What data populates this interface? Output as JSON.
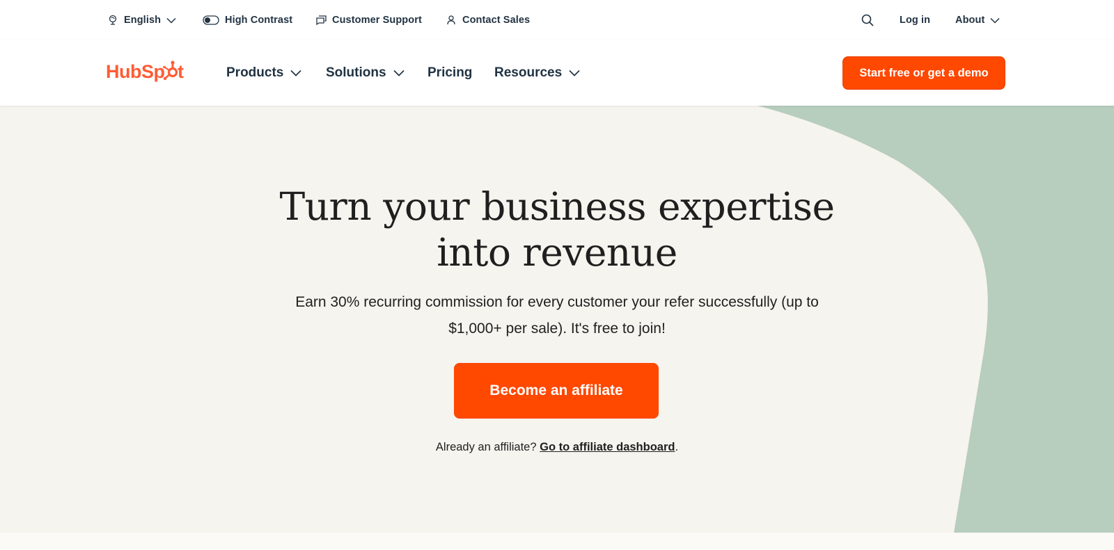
{
  "utility_bar": {
    "language": "English",
    "high_contrast": "High Contrast",
    "customer_support": "Customer Support",
    "contact_sales": "Contact Sales",
    "login": "Log in",
    "about": "About"
  },
  "nav": {
    "logo_text": "HubSpot",
    "items": [
      "Products",
      "Solutions",
      "Pricing",
      "Resources"
    ],
    "cta": "Start free or get a demo"
  },
  "hero": {
    "title_line1": "Turn your business expertise",
    "title_line2": "into revenue",
    "subtitle": "Earn 30% recurring commission for every customer your refer successfully (up to $1,000+ per sale). It's free to join!",
    "button": "Become an affiliate",
    "already_text": "Already an affiliate? ",
    "dashboard_link": "Go to affiliate dashboard",
    "period": "."
  },
  "colors": {
    "brand_orange": "#ff4800",
    "hero_bg": "#f6f4ee",
    "hero_accent": "#b7cdbd",
    "text_dark": "#213343"
  },
  "icons": [
    "globe-icon",
    "contrast-toggle-icon",
    "chat-icon",
    "person-icon",
    "search-icon",
    "chevron-down-icon"
  ]
}
